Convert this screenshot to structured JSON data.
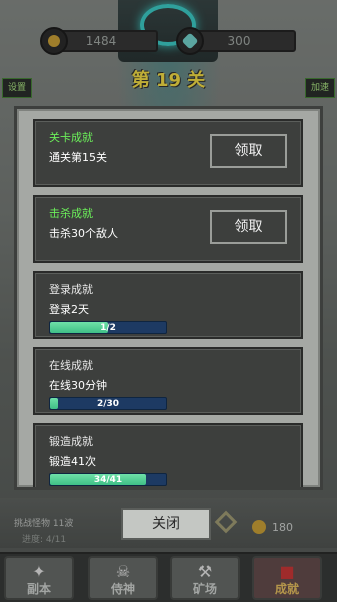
{
  "hud": {
    "coins": "1484",
    "gems": "300",
    "level_title": "第 19 关",
    "settings_label": "设置",
    "speed_label": "加速"
  },
  "bottom": {
    "wave_label": "挑战怪物 11波",
    "progress_label": "进度: 4/11",
    "coin_count": "180"
  },
  "nav": [
    {
      "label": "副本",
      "icon": "dungeon-icon"
    },
    {
      "label": "侍神",
      "icon": "skull-icon"
    },
    {
      "label": "矿场",
      "icon": "pickaxe-icon"
    },
    {
      "label": "成就",
      "icon": "achievement-icon"
    }
  ],
  "achievements": [
    {
      "title": "关卡成就",
      "desc": "通关第15关",
      "status": "claimable",
      "button": "领取"
    },
    {
      "title": "击杀成就",
      "desc": "击杀30个敌人",
      "status": "claimable",
      "button": "领取"
    },
    {
      "title": "登录成就",
      "desc": "登录2天",
      "status": "progress",
      "progress_text": "1/2",
      "progress": 0.5
    },
    {
      "title": "在线成就",
      "desc": "在线30分钟",
      "status": "progress",
      "progress_text": "2/30",
      "progress": 0.067
    },
    {
      "title": "锻造成就",
      "desc": "锻造41次",
      "status": "progress",
      "progress_text": "34/41",
      "progress": 0.83
    }
  ],
  "modal": {
    "close_label": "关闭"
  },
  "colors": {
    "claimable_title": "#6cf05a",
    "progress_fill": "#3fbf86",
    "progress_track": "#1d3a63",
    "level_title": "#ffe84a"
  }
}
